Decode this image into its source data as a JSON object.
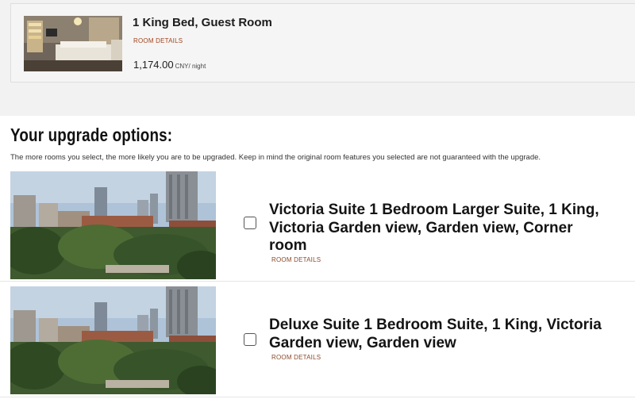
{
  "booked_room": {
    "title": "1 King Bed, Guest Room",
    "details_link": "ROOM DETAILS",
    "price": "1,174.00",
    "price_unit": "CNY/ night"
  },
  "upgrade": {
    "heading": "Your upgrade options:",
    "description": "The more rooms you select, the more likely you are to be upgraded. Keep in mind the original room features you selected are not guaranteed with the upgrade.",
    "options": [
      {
        "name": "Victoria Suite 1 Bedroom Larger Suite, 1 King, Victoria Garden view, Garden view, Corner room",
        "details_link": "ROOM DETAILS",
        "checked": false
      },
      {
        "name": "Deluxe Suite 1 Bedroom Suite, 1 King, Victoria Garden view, Garden view",
        "details_link": "ROOM DETAILS",
        "checked": false
      }
    ]
  },
  "colors": {
    "link": "#a0431c",
    "page_band": "#f2f2f2"
  }
}
